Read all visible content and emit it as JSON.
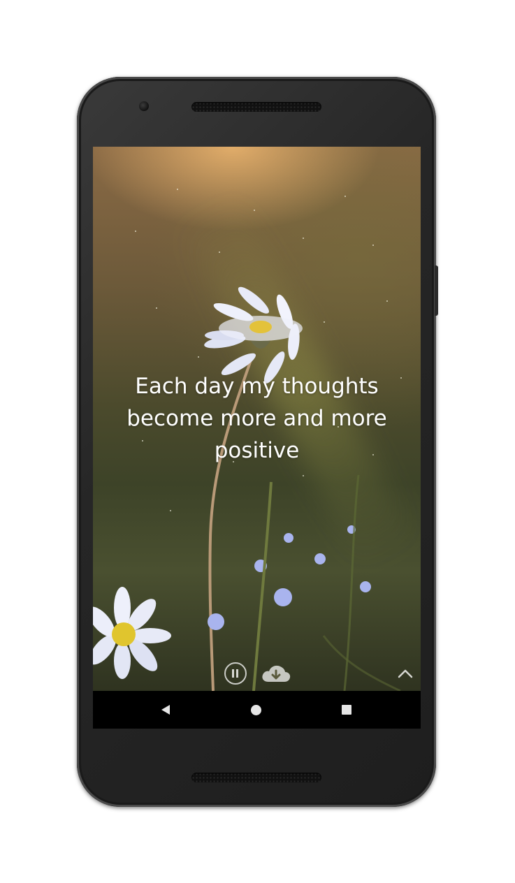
{
  "quote": {
    "text": "Each day my thoughts become more and more positive"
  },
  "controls": {
    "pause_icon": "pause-circle-icon",
    "download_icon": "cloud-download-icon",
    "expand_icon": "chevron-up-icon"
  },
  "navigation_bar": {
    "back_icon": "triangle-back-icon",
    "home_icon": "circle-home-icon",
    "recents_icon": "square-recents-icon"
  },
  "colors": {
    "quote_text": "#ffffff",
    "nav_background": "#000000",
    "nav_icons": "#e6e6e6"
  }
}
